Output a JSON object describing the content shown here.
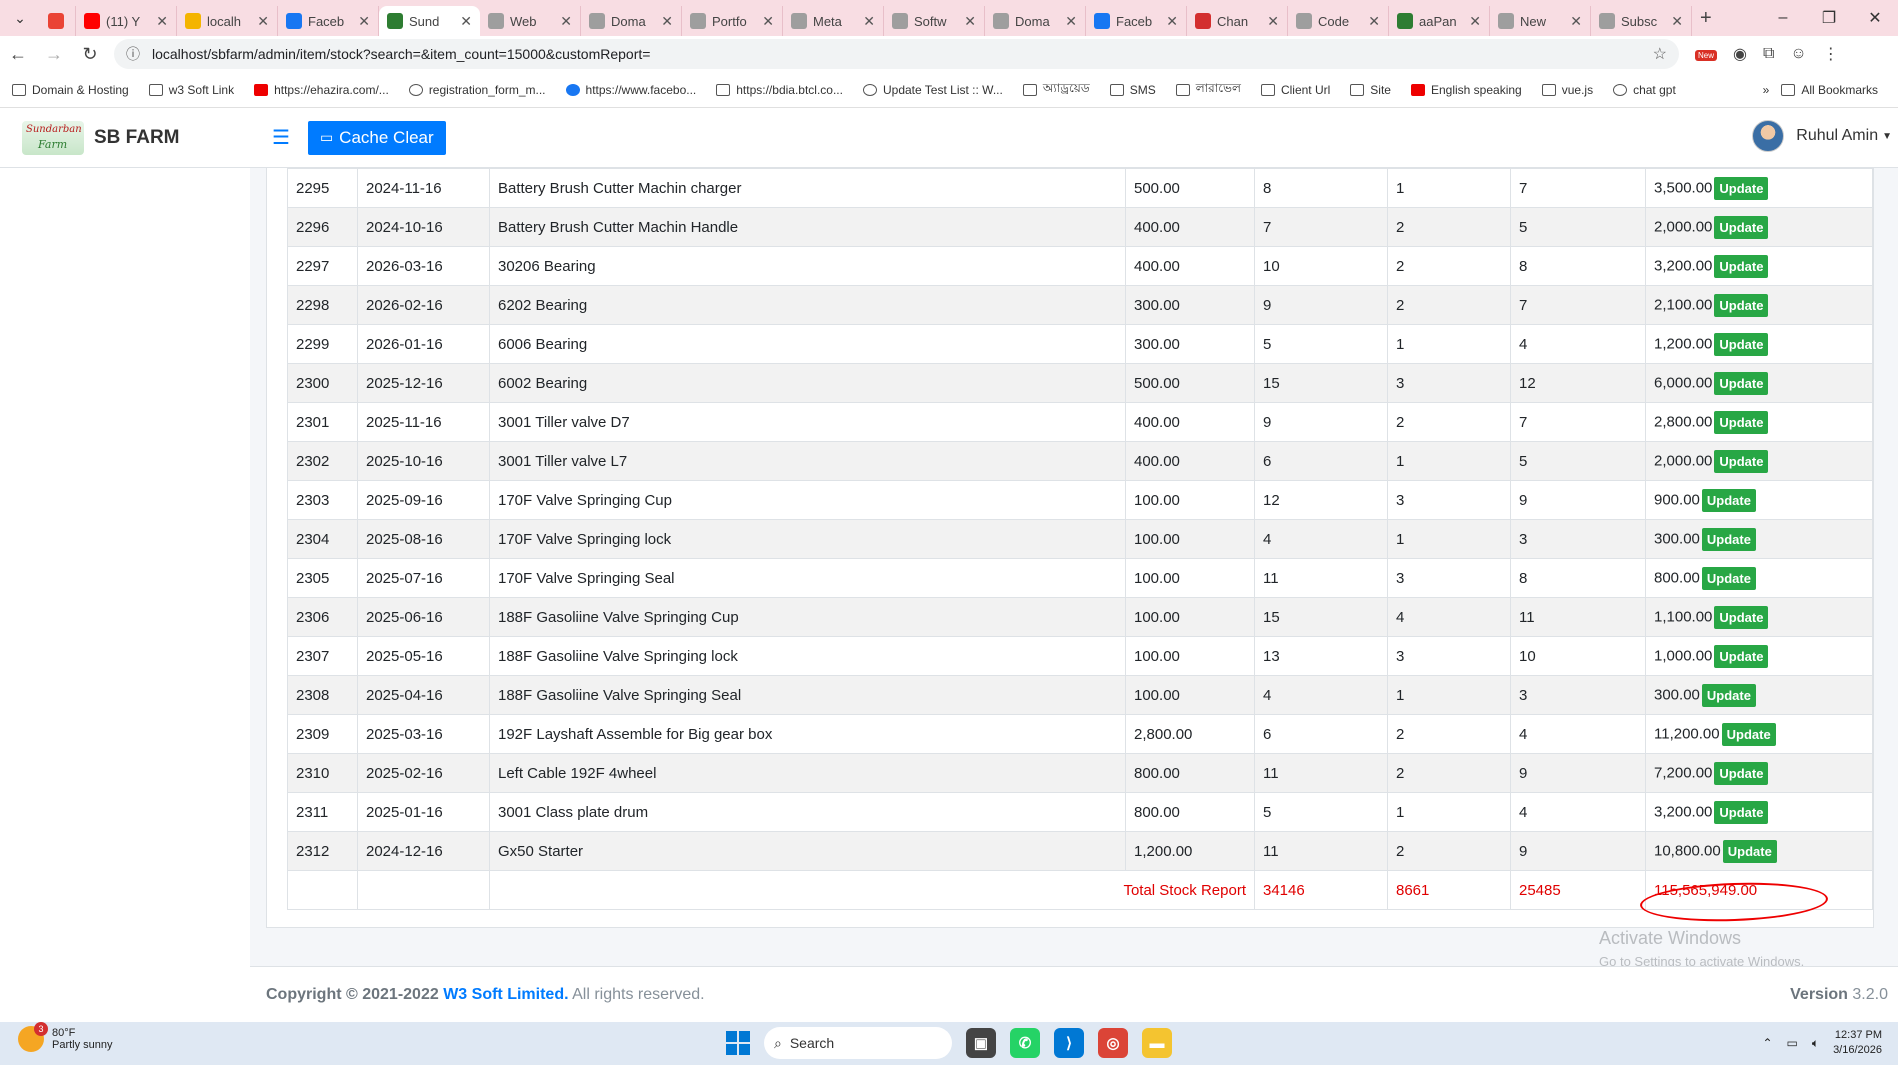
{
  "browser": {
    "tabs": [
      {
        "label": "",
        "color": "#ea4335"
      },
      {
        "label": "(11) Y",
        "color": "#ff0000"
      },
      {
        "label": "localh",
        "color": "#f4b400"
      },
      {
        "label": "Faceb",
        "color": "#1877f2"
      },
      {
        "label": "Sund",
        "color": "#2e7d32",
        "active": true
      },
      {
        "label": "Web",
        "color": "#9e9e9e"
      },
      {
        "label": "Doma",
        "color": "#9e9e9e"
      },
      {
        "label": "Portfo",
        "color": "#9e9e9e"
      },
      {
        "label": "Meta",
        "color": "#9e9e9e"
      },
      {
        "label": "Softw",
        "color": "#9e9e9e"
      },
      {
        "label": "Doma",
        "color": "#9e9e9e"
      },
      {
        "label": "Faceb",
        "color": "#1877f2"
      },
      {
        "label": "Chan",
        "color": "#d32f2f"
      },
      {
        "label": "Code",
        "color": "#9e9e9e"
      },
      {
        "label": "aaPan",
        "color": "#2e7d32"
      },
      {
        "label": "New",
        "color": "#9e9e9e"
      },
      {
        "label": "Subsc",
        "color": "#9e9e9e"
      }
    ],
    "url": "localhost/sbfarm/admin/item/stock?search=&item_count=15000&customReport=",
    "new_badge": "New",
    "bookmarks": [
      "Domain & Hosting",
      "w3 Soft Link",
      "https://ehazira.com/...",
      "registration_form_m...",
      "https://www.facebo...",
      "https://bdia.btcl.co...",
      "Update Test List :: W...",
      "অ্যাড্রয়েড",
      "SMS",
      "লারাভেল",
      "Client Url",
      "Site",
      "English speaking",
      "vue.js",
      "chat gpt"
    ],
    "all_bookmarks": "All Bookmarks"
  },
  "app": {
    "logo_line1": "Sundarban",
    "logo_line2": "Farm",
    "brand": "SB FARM",
    "cache_clear": "Cache Clear",
    "user_name": "Ruhul Amin"
  },
  "table": {
    "rows": [
      {
        "id": "2295",
        "date": "2024-11-16",
        "name": "Battery Brush Cutter Machin charger",
        "price": "500.00",
        "c1": "8",
        "c2": "1",
        "c3": "7",
        "amount": "3,500.00"
      },
      {
        "id": "2296",
        "date": "2024-10-16",
        "name": "Battery Brush Cutter Machin Handle",
        "price": "400.00",
        "c1": "7",
        "c2": "2",
        "c3": "5",
        "amount": "2,000.00"
      },
      {
        "id": "2297",
        "date": "2026-03-16",
        "name": "30206 Bearing",
        "price": "400.00",
        "c1": "10",
        "c2": "2",
        "c3": "8",
        "amount": "3,200.00"
      },
      {
        "id": "2298",
        "date": "2026-02-16",
        "name": "6202 Bearing",
        "price": "300.00",
        "c1": "9",
        "c2": "2",
        "c3": "7",
        "amount": "2,100.00"
      },
      {
        "id": "2299",
        "date": "2026-01-16",
        "name": "6006 Bearing",
        "price": "300.00",
        "c1": "5",
        "c2": "1",
        "c3": "4",
        "amount": "1,200.00"
      },
      {
        "id": "2300",
        "date": "2025-12-16",
        "name": "6002 Bearing",
        "price": "500.00",
        "c1": "15",
        "c2": "3",
        "c3": "12",
        "amount": "6,000.00"
      },
      {
        "id": "2301",
        "date": "2025-11-16",
        "name": "3001 Tiller valve D7",
        "price": "400.00",
        "c1": "9",
        "c2": "2",
        "c3": "7",
        "amount": "2,800.00"
      },
      {
        "id": "2302",
        "date": "2025-10-16",
        "name": "3001 Tiller valve L7",
        "price": "400.00",
        "c1": "6",
        "c2": "1",
        "c3": "5",
        "amount": "2,000.00"
      },
      {
        "id": "2303",
        "date": "2025-09-16",
        "name": "170F Valve Springing Cup",
        "price": "100.00",
        "c1": "12",
        "c2": "3",
        "c3": "9",
        "amount": "900.00"
      },
      {
        "id": "2304",
        "date": "2025-08-16",
        "name": "170F Valve Springing lock",
        "price": "100.00",
        "c1": "4",
        "c2": "1",
        "c3": "3",
        "amount": "300.00"
      },
      {
        "id": "2305",
        "date": "2025-07-16",
        "name": "170F Valve Springing Seal",
        "price": "100.00",
        "c1": "11",
        "c2": "3",
        "c3": "8",
        "amount": "800.00"
      },
      {
        "id": "2306",
        "date": "2025-06-16",
        "name": "188F Gasoliine Valve Springing Cup",
        "price": "100.00",
        "c1": "15",
        "c2": "4",
        "c3": "11",
        "amount": "1,100.00"
      },
      {
        "id": "2307",
        "date": "2025-05-16",
        "name": "188F Gasoliine Valve Springing lock",
        "price": "100.00",
        "c1": "13",
        "c2": "3",
        "c3": "10",
        "amount": "1,000.00"
      },
      {
        "id": "2308",
        "date": "2025-04-16",
        "name": "188F Gasoliine Valve Springing Seal",
        "price": "100.00",
        "c1": "4",
        "c2": "1",
        "c3": "3",
        "amount": "300.00"
      },
      {
        "id": "2309",
        "date": "2025-03-16",
        "name": "192F Layshaft Assemble for Big gear box",
        "price": "2,800.00",
        "c1": "6",
        "c2": "2",
        "c3": "4",
        "amount": "11,200.00"
      },
      {
        "id": "2310",
        "date": "2025-02-16",
        "name": "Left Cable 192F 4wheel",
        "price": "800.00",
        "c1": "11",
        "c2": "2",
        "c3": "9",
        "amount": "7,200.00"
      },
      {
        "id": "2311",
        "date": "2025-01-16",
        "name": "3001 Class plate drum",
        "price": "800.00",
        "c1": "5",
        "c2": "1",
        "c3": "4",
        "amount": "3,200.00"
      },
      {
        "id": "2312",
        "date": "2024-12-16",
        "name": "Gx50 Starter",
        "price": "1,200.00",
        "c1": "11",
        "c2": "2",
        "c3": "9",
        "amount": "10,800.00"
      }
    ],
    "update_label": "Update",
    "total": {
      "label": "Total Stock Report",
      "c1": "34146",
      "c2": "8661",
      "c3": "25485",
      "amount": "115,565,949.00"
    }
  },
  "watermark": {
    "line1": "Activate Windows",
    "line2": "Go to Settings to activate Windows."
  },
  "footer": {
    "copyright": "Copyright © 2021-2022",
    "company": "W3 Soft Limited.",
    "rights": "All rights reserved.",
    "version_label": "Version",
    "version": "3.2.0"
  },
  "taskbar": {
    "temp": "80°F",
    "weather": "Partly sunny",
    "weather_badge": "3",
    "search": "Search",
    "time": "12:37 PM",
    "date": "3/16/2026"
  }
}
